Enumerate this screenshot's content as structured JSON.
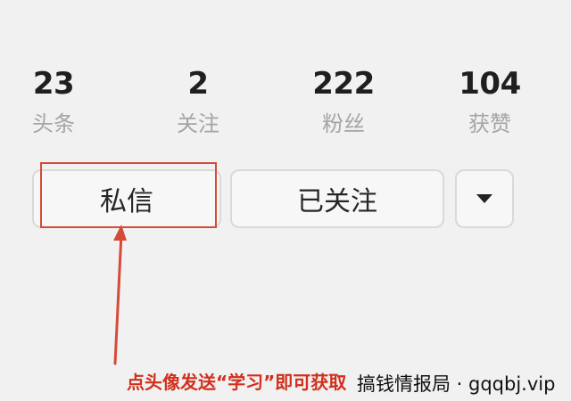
{
  "profile": {
    "stats": [
      {
        "value": "23",
        "label": "头条"
      },
      {
        "value": "2",
        "label": "关注"
      },
      {
        "value": "222",
        "label": "粉丝"
      },
      {
        "value": "104",
        "label": "获赞"
      }
    ],
    "actions": {
      "message_label": "私信",
      "followed_label": "已关注",
      "more_icon": "triangle-down-icon"
    }
  },
  "annotation": {
    "caption": "点头像发送“学习”即可获取",
    "watermark": "搞钱情报局 · gqqbj.vip",
    "accent_color": "#d64a38"
  }
}
